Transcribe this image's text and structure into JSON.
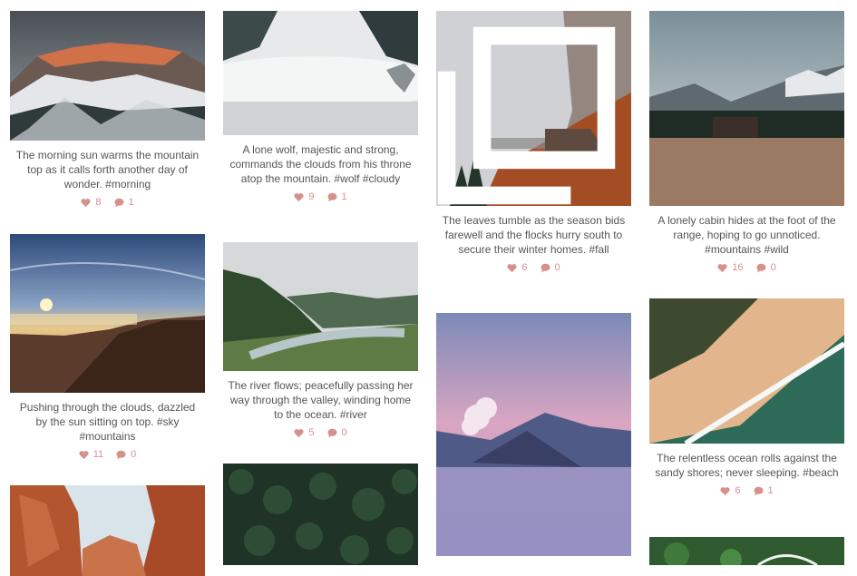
{
  "accent_color": "#d6918d",
  "posts": [
    {
      "caption": "The morning sun warms the mountain top as it calls forth another day of wonder. #morning",
      "likes": "8",
      "comments": "1",
      "image": "snowy-mountain-sunrise"
    },
    {
      "caption": "A lone wolf, majestic and strong, commands the clouds from his throne atop the mountain. #wolf #cloudy",
      "likes": "9",
      "comments": "1",
      "image": "wolf-clouds"
    },
    {
      "caption": "The leaves tumble as the season bids farewell and the flocks hurry south to secure their winter homes. #fall",
      "likes": "6",
      "comments": "0",
      "image": "foggy-autumn-forest"
    },
    {
      "caption": "A lonely cabin hides at the foot of the range, hoping to go unnoticed. #mountains #wild",
      "likes": "16",
      "comments": "0",
      "image": "mountain-cabin"
    },
    {
      "caption": "Pushing through the clouds, dazzled by the sun sitting on top. #sky #mountains",
      "likes": "11",
      "comments": "0",
      "image": "sunset-over-clouds"
    },
    {
      "caption": "The river flows; peacefully passing her way through the valley, winding home to the ocean. #river",
      "likes": "5",
      "comments": "0",
      "image": "river-valley"
    },
    {
      "caption": "",
      "likes": "",
      "comments": "",
      "image": "volcano-pink-sky"
    },
    {
      "caption": "The relentless ocean rolls against the sandy shores; never sleeping. #beach",
      "likes": "6",
      "comments": "1",
      "image": "beach-aerial"
    },
    {
      "caption": "",
      "likes": "",
      "comments": "",
      "image": "red-canyon"
    },
    {
      "caption": "",
      "likes": "",
      "comments": "",
      "image": "pine-forest-aerial"
    },
    {
      "caption": "",
      "likes": "",
      "comments": "",
      "image": "green-aerial"
    }
  ]
}
